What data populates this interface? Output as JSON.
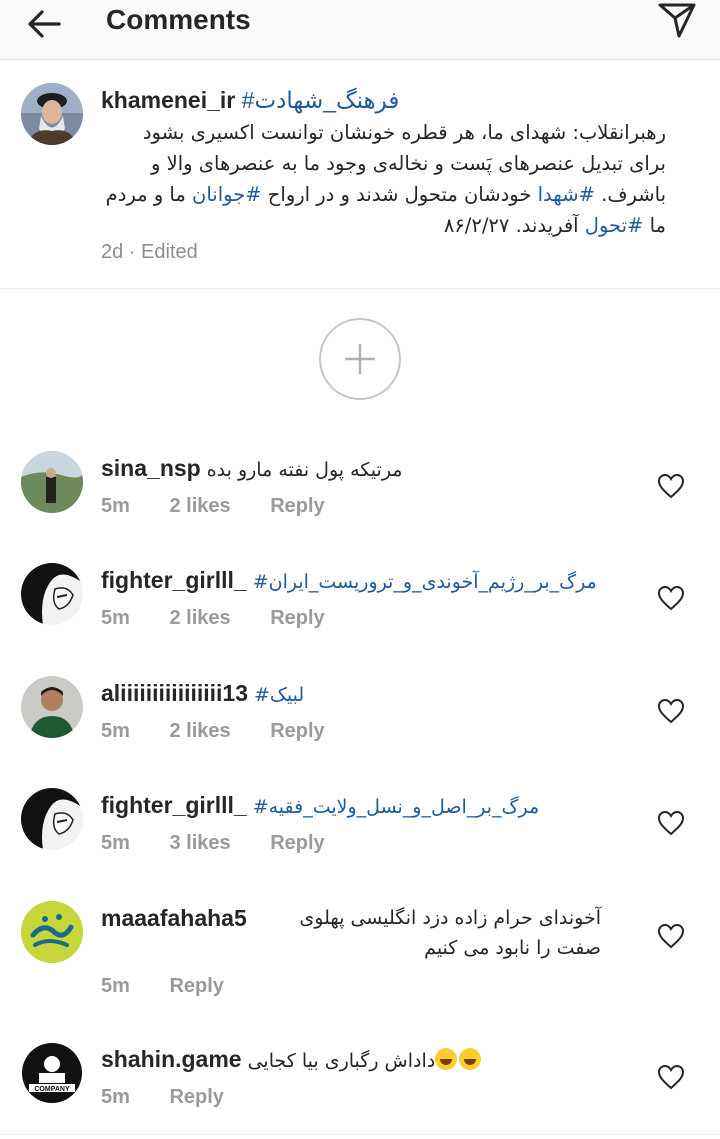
{
  "header": {
    "title": "Comments",
    "back_icon": "arrow-left-icon",
    "send_icon": "paper-plane-icon"
  },
  "post": {
    "username": "khamenei_ir",
    "hashtag": "#فرهنگ_شهادت",
    "body_parts": [
      {
        "text": "رهبرانقلاب: شهدای ما، هر قطره خونشان توانست اکسیری بشود برای تبدیل عنصرهای پَست و نخاله‌ی وجود ما به عنصرهای والا و باشرف. ",
        "tag": false
      },
      {
        "text": "#شهدا",
        "tag": true
      },
      {
        "text": " خودشان متحول شدند و در ارواح ",
        "tag": false
      },
      {
        "text": "#جوانان",
        "tag": true
      },
      {
        "text": " ما و مردم ما ",
        "tag": false
      },
      {
        "text": "#تحول",
        "tag": true
      },
      {
        "text": " آفریدند. ۸۶/۲/۲۷",
        "tag": false
      }
    ],
    "meta": "2d · Edited"
  },
  "load_more_icon": "plus-circle-icon",
  "comments": [
    {
      "username": "sina_nsp",
      "text": "مرتیکه پول نفته مارو بده",
      "tag": "",
      "time": "5m",
      "likes": "2 likes",
      "reply": "Reply"
    },
    {
      "username": "fighter_girlll_",
      "text": "",
      "tag": "#مرگ_بر_رژیم_آخوندی_و_تروریست_ایران",
      "time": "5m",
      "likes": "2 likes",
      "reply": "Reply"
    },
    {
      "username": "aliiiiiiiiiiiiiiii13",
      "text": "",
      "tag": "#لبیک",
      "time": "5m",
      "likes": "2 likes",
      "reply": "Reply"
    },
    {
      "username": "fighter_girlll_",
      "text": "",
      "tag": "#مرگ_بر_اصل_و_نسل_ولایت_فقیه",
      "time": "5m",
      "likes": "3 likes",
      "reply": "Reply"
    },
    {
      "username": "maaafahaha5",
      "text": "آخوندای حرام زاده دزد انگلیسی پهلوی صفت را نابود می کنیم",
      "tag": "",
      "time": "5m",
      "likes": "",
      "reply": "Reply"
    },
    {
      "username": "shahin.game",
      "text": "داداش رگباری بیا کجایی",
      "tag": "",
      "emoji": "😂😂",
      "time": "5m",
      "likes": "",
      "reply": "Reply"
    }
  ],
  "colors": {
    "hashtag": "#1f5b9a",
    "muted": "#8e8e8e"
  }
}
